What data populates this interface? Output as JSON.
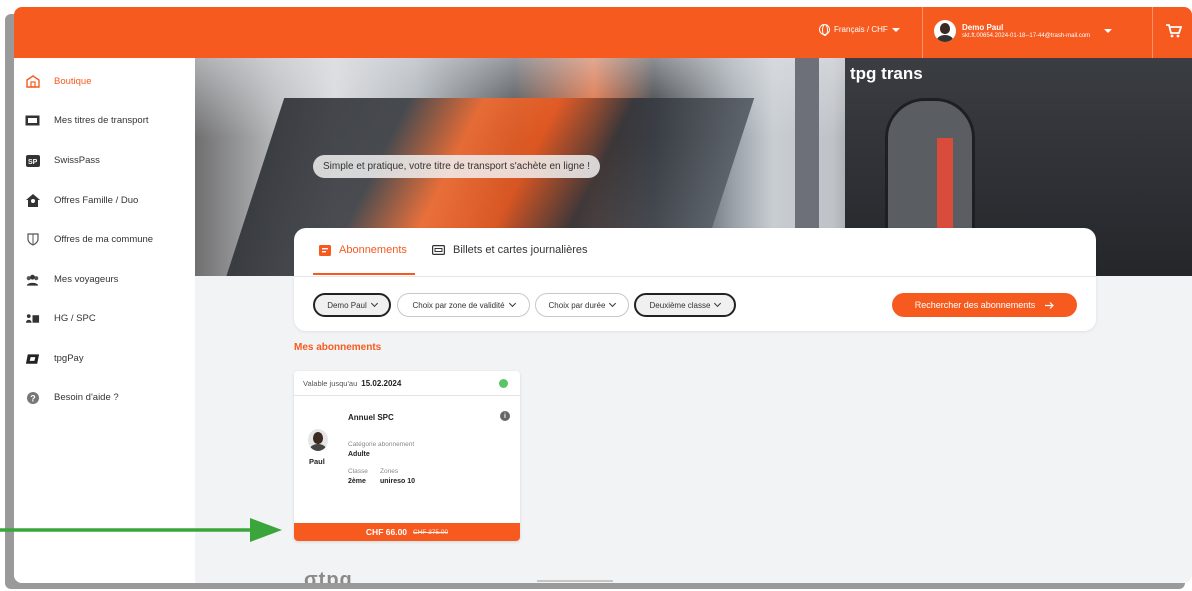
{
  "header": {
    "language": "Français / CHF",
    "user_name": "Demo Paul",
    "user_email": "skt.ft.00654.2024-01-18--17-44@trash-mail.com"
  },
  "sidebar": {
    "items": [
      {
        "label": "Boutique",
        "icon": "shop-icon"
      },
      {
        "label": "Mes titres de transport",
        "icon": "ticket-icon"
      },
      {
        "label": "SwissPass",
        "icon": "swisspass-icon"
      },
      {
        "label": "Offres Famille / Duo",
        "icon": "family-home-icon"
      },
      {
        "label": "Offres de ma commune",
        "icon": "shield-icon"
      },
      {
        "label": "Mes voyageurs",
        "icon": "travellers-icon"
      },
      {
        "label": "HG / SPC",
        "icon": "hg-spc-icon"
      },
      {
        "label": "tpgPay",
        "icon": "tpgpay-icon"
      },
      {
        "label": "Besoin d'aide ?",
        "icon": "help-icon"
      }
    ]
  },
  "hero": {
    "brand": "tpg trans",
    "tagline": "Simple et pratique, votre titre de transport s'achète en ligne !"
  },
  "tabs": {
    "abonnements": "Abonnements",
    "billets": "Billets et cartes journalières"
  },
  "filters": {
    "traveller": "Demo Paul",
    "zone": "Choix par zone de validité",
    "duration": "Choix par durée",
    "class": "Deuxième classe",
    "search_button": "Rechercher des abonnements"
  },
  "section_title": "Mes abonnements",
  "subscription": {
    "valid_label": "Valable jusqu'au",
    "valid_date": "15.02.2024",
    "status_color": "#5ac46a",
    "title": "Annuel SPC",
    "person": "Paul",
    "category_label": "Catégorie abonnement",
    "category": "Adulte",
    "class_label": "Classe",
    "class_value": "2ème",
    "zones_label": "Zones",
    "zones_value": "unireso 10",
    "price": "CHF 66.00",
    "old_price": "CHF 375.00"
  },
  "footer": {
    "logo": "σtpg"
  },
  "colors": {
    "accent": "#f75a1f",
    "annotation_arrow": "#3aa53a"
  }
}
